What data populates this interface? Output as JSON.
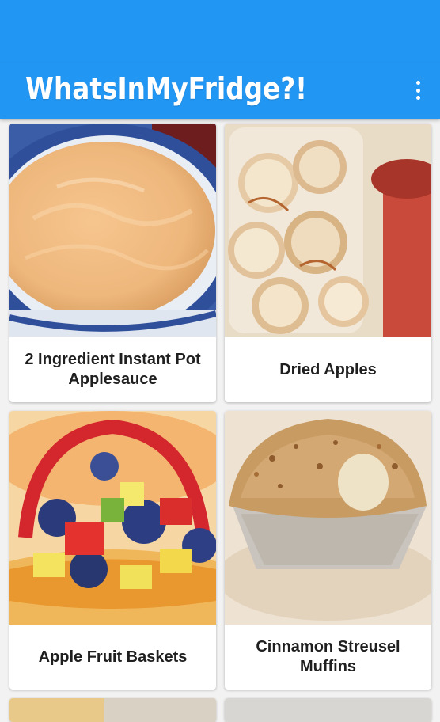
{
  "app": {
    "title": "WhatsInMyFridge?!"
  },
  "recipes": [
    {
      "name": "2 Ingredient Instant Pot Applesauce"
    },
    {
      "name": "Dried Apples"
    },
    {
      "name": "Apple Fruit Baskets"
    },
    {
      "name": "Cinnamon Streusel Muffins"
    }
  ],
  "colors": {
    "app_bar": "#2196f3",
    "background": "#f2f2f2"
  },
  "icons": {
    "menu": "more-vert-icon"
  }
}
